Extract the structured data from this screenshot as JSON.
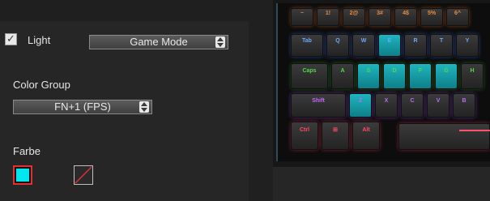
{
  "light": {
    "label": "Light",
    "checked": true,
    "checkmark": "✓"
  },
  "mode_select": {
    "value": "Game Mode"
  },
  "color_group": {
    "label": "Color Group",
    "value": "FN+1 (FPS)"
  },
  "farbe": {
    "label": "Farbe",
    "active_color": "#00e5f0",
    "active_border": "#e03030"
  },
  "keyboard": {
    "row1": [
      "~",
      "1!",
      "2@",
      "3#",
      "4$",
      "5%",
      "6^"
    ],
    "row2": [
      "Tab",
      "Q",
      "W",
      "E",
      "R",
      "T",
      "Y"
    ],
    "row3": [
      "Caps",
      "A",
      "S",
      "D",
      "F",
      "G",
      "H"
    ],
    "row4": [
      "Shift",
      "Z",
      "X",
      "C",
      "V",
      "B"
    ],
    "row5": [
      "Ctrl",
      "⊞",
      "Alt"
    ],
    "lit_color": "#1fb5bf"
  },
  "icons": {
    "checkbox": "check-icon",
    "spinner": "up-down-arrows-icon",
    "no_color": "diagonal-slash-icon"
  }
}
